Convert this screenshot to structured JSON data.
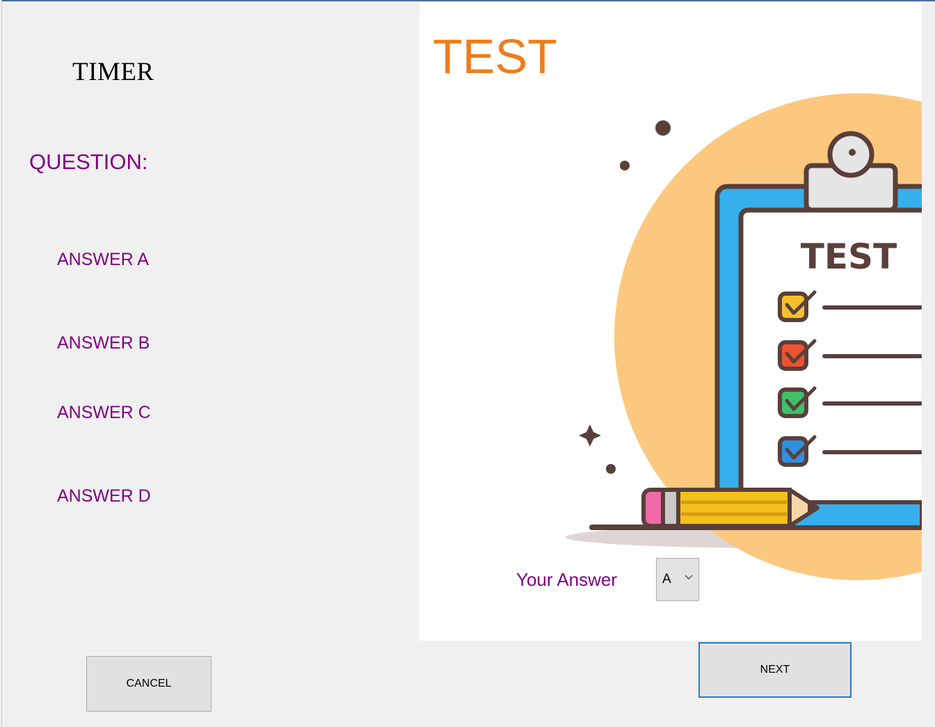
{
  "timer_label": "TIMER",
  "question_label": "QUESTION:",
  "answers": [
    "ANSWER A",
    "ANSWER B",
    "ANSWER C",
    "ANSWER D"
  ],
  "test_title": "TEST",
  "illustration": {
    "clipboard_heading": "TEST",
    "checkbox_colors": [
      "#f6bf2c",
      "#f0522e",
      "#3fbf6a",
      "#2f8fe0"
    ]
  },
  "your_answer_label": "Your Answer",
  "answer_select": {
    "value": "A"
  },
  "buttons": {
    "cancel": "CANCEL",
    "next": "NEXT"
  },
  "colors": {
    "label_purple": "#800080",
    "title_orange": "#ef7d1a",
    "window_bg": "#f0f0f0"
  }
}
